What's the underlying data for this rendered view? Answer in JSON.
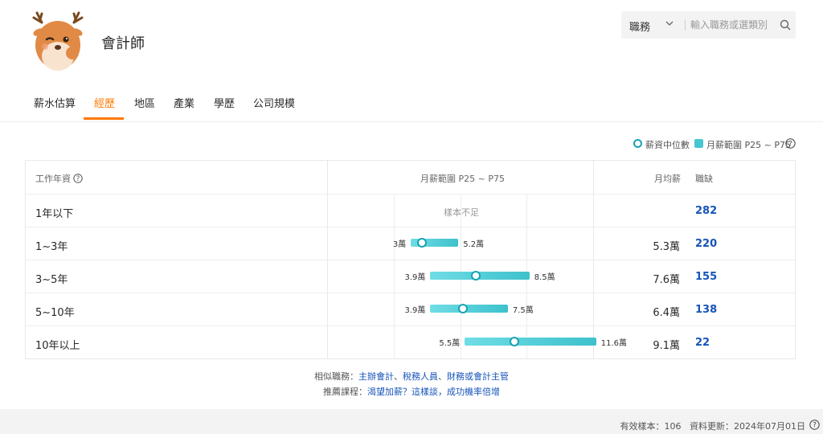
{
  "header": {
    "job_title": "會計師",
    "avatar_icon": "deer-mascot-icon"
  },
  "search": {
    "category_value": "職務",
    "placeholder": "輸入職務或選類別"
  },
  "tabs": [
    {
      "label": "薪水估算",
      "active": false
    },
    {
      "label": "經歷",
      "active": true
    },
    {
      "label": "地區",
      "active": false
    },
    {
      "label": "產業",
      "active": false
    },
    {
      "label": "學歷",
      "active": false
    },
    {
      "label": "公司規模",
      "active": false
    }
  ],
  "legend": {
    "median_label": "薪資中位數",
    "range_label": "月薪範圍 P25 ~ P75"
  },
  "table": {
    "headers": {
      "experience": "工作年資",
      "range": "月薪範圍 P25 ~ P75",
      "avg": "月均薪",
      "vacancies": "職缺"
    },
    "rows": [
      {
        "label": "1年以下",
        "insufficient": "樣本不足",
        "p25": null,
        "median": null,
        "p75": null,
        "p25_label": "",
        "p75_label": "",
        "avg": "",
        "vacancies": "282"
      },
      {
        "label": "1~3年",
        "insufficient": "",
        "p25": 3.0,
        "median": 3.5,
        "p75": 5.2,
        "p25_label": "3萬",
        "p75_label": "5.2萬",
        "avg": "5.3萬",
        "vacancies": "220"
      },
      {
        "label": "3~5年",
        "insufficient": "",
        "p25": 3.9,
        "median": 6.0,
        "p75": 8.5,
        "p25_label": "3.9萬",
        "p75_label": "8.5萬",
        "avg": "7.6萬",
        "vacancies": "155"
      },
      {
        "label": "5~10年",
        "insufficient": "",
        "p25": 3.9,
        "median": 5.4,
        "p75": 7.5,
        "p25_label": "3.9萬",
        "p75_label": "7.5萬",
        "avg": "6.4萬",
        "vacancies": "138"
      },
      {
        "label": "10年以上",
        "insufficient": "",
        "p25": 5.5,
        "median": 7.8,
        "p75": 11.6,
        "p25_label": "5.5萬",
        "p75_label": "11.6萬",
        "avg": "9.1萬",
        "vacancies": "22"
      }
    ]
  },
  "related": {
    "similar_label": "相似職務：",
    "similar_jobs": [
      "主辦會計",
      "稅務人員",
      "財務或會計主管"
    ],
    "separator": "、",
    "course_label": "推薦課程：",
    "course_link": "渴望加薪？這樣談，成功機率倍增"
  },
  "footer": {
    "sample_label": "有效樣本：106",
    "updated_label": "資料更新：2024年07月01日"
  },
  "colors": {
    "accent": "#ff7800",
    "link": "#1654b9",
    "bar": "#48c6d2",
    "median_ring": "#17a3b3"
  }
}
